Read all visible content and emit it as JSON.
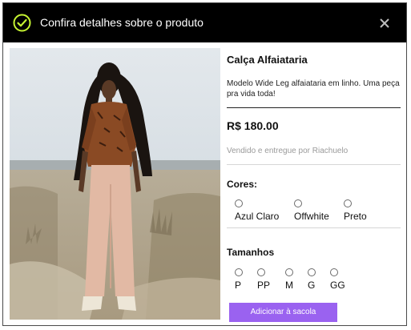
{
  "header": {
    "title": "Confira detalhes sobre o produto",
    "icons": {
      "status": "check-circle-icon",
      "close": "close-icon"
    }
  },
  "product": {
    "image_alt": "photo-of-model-wearing-wide-leg-pants",
    "name": "Calça Alfaiataria",
    "description": "Modelo Wide Leg alfaiataria em linho. Uma peça pra vida toda!",
    "price": "R$ 180.00",
    "seller": "Vendido e entregue por Riachuelo"
  },
  "colors": {
    "title": "Cores:",
    "options": [
      "Azul Claro",
      "Offwhite",
      "Preto"
    ]
  },
  "sizes": {
    "title": "Tamanhos",
    "options": [
      "P",
      "PP",
      "M",
      "G",
      "GG"
    ]
  },
  "actions": {
    "add_to_bag": "Adicionar à sacola"
  },
  "theme": {
    "accent": "#9a62f0",
    "header_bg": "#000000",
    "check_color": "#c6f432"
  }
}
